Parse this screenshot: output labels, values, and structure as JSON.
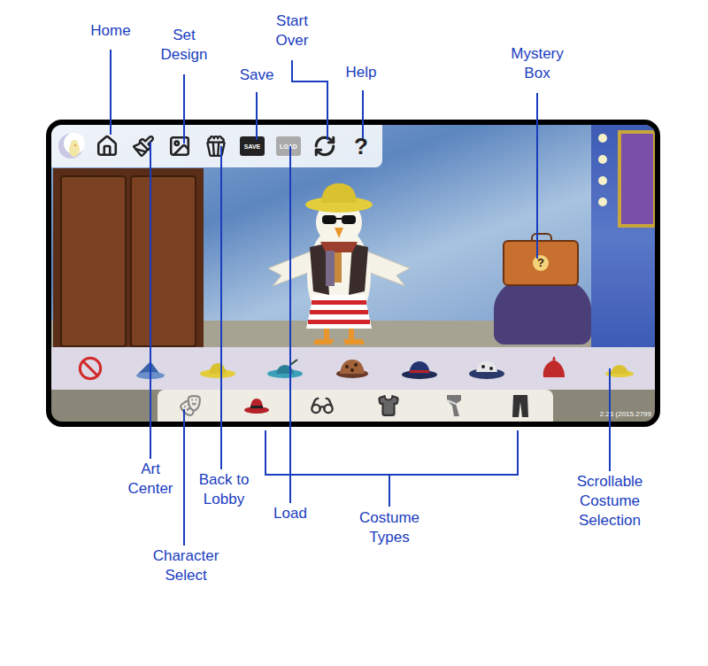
{
  "callouts": [
    {
      "label": "Home"
    },
    {
      "label": "Set Design"
    },
    {
      "label": "Start Over"
    },
    {
      "label": "Save"
    },
    {
      "label": "Help"
    },
    {
      "label": "Mystery Box"
    },
    {
      "label": "Art Center"
    },
    {
      "label": "Back to Lobby"
    },
    {
      "label": "Load"
    },
    {
      "label": "Costume Types"
    },
    {
      "label": "Scrollable Costume Selection"
    },
    {
      "label": "Character Select"
    }
  ],
  "toolbar": [
    {
      "kind": "logo",
      "caption": "",
      "disabled": false
    },
    {
      "kind": "home",
      "caption": "",
      "disabled": false
    },
    {
      "kind": "art",
      "caption": "",
      "disabled": false
    },
    {
      "kind": "set",
      "caption": "",
      "disabled": false
    },
    {
      "kind": "lobby",
      "caption": "",
      "disabled": false
    },
    {
      "kind": "save",
      "caption": "SAVE",
      "disabled": false
    },
    {
      "kind": "load",
      "caption": "LOAD",
      "disabled": true
    },
    {
      "kind": "restart",
      "caption": "",
      "disabled": false
    },
    {
      "kind": "help",
      "caption": "?",
      "disabled": false
    }
  ],
  "mystery_box": {
    "mark": "?"
  },
  "costume_types": [
    {
      "kind": "character",
      "selected": false
    },
    {
      "kind": "hat",
      "selected": true
    },
    {
      "kind": "glasses",
      "selected": false
    },
    {
      "kind": "shirt",
      "selected": false
    },
    {
      "kind": "scarf",
      "selected": false
    },
    {
      "kind": "pants",
      "selected": false
    }
  ],
  "version": "2.26 (2015.2799"
}
